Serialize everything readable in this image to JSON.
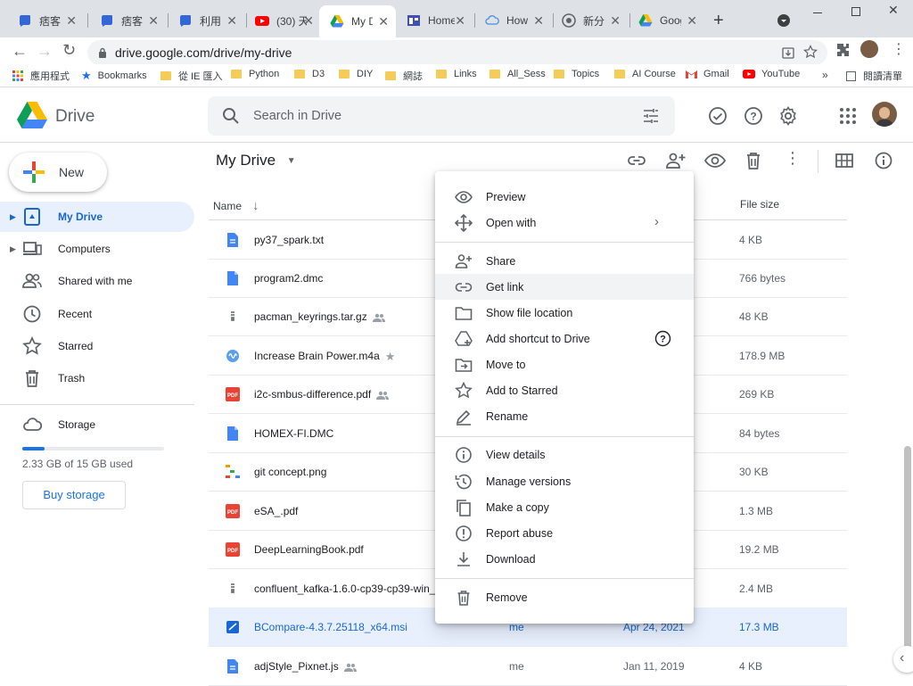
{
  "browser": {
    "tabs": [
      {
        "title": "痞客邦",
        "icon": "pixnet-icon"
      },
      {
        "title": "痞客邦",
        "icon": "pixnet-icon"
      },
      {
        "title": "利用雲",
        "icon": "pixnet-icon"
      },
      {
        "title": "(30) 天",
        "icon": "youtube-icon"
      },
      {
        "title": "My Dr",
        "icon": "drive-icon"
      },
      {
        "title": "Home",
        "icon": "home-icon"
      },
      {
        "title": "How t",
        "icon": "cloud-icon"
      },
      {
        "title": "新分頁",
        "icon": "chrome-icon"
      },
      {
        "title": "Googl",
        "icon": "drive-icon"
      }
    ],
    "url": "drive.google.com/drive/my-drive",
    "bookmarks": [
      {
        "label": "應用程式",
        "icon": "apps-grid-icon"
      },
      {
        "label": "Bookmarks",
        "icon": "star-icon"
      },
      {
        "label": "從 IE 匯入",
        "icon": "folder-icon"
      },
      {
        "label": "Python",
        "icon": "folder-icon"
      },
      {
        "label": "D3",
        "icon": "folder-icon"
      },
      {
        "label": "DIY",
        "icon": "folder-icon"
      },
      {
        "label": "網誌",
        "icon": "folder-icon"
      },
      {
        "label": "Links",
        "icon": "folder-icon"
      },
      {
        "label": "All_Sess",
        "icon": "folder-icon"
      },
      {
        "label": "Topics",
        "icon": "folder-icon"
      },
      {
        "label": "AI Course",
        "icon": "folder-icon"
      },
      {
        "label": "Gmail",
        "icon": "gmail-icon"
      },
      {
        "label": "YouTube",
        "icon": "youtube-icon"
      }
    ],
    "more_bookmarks": "»",
    "reading_list": "閱讀清單"
  },
  "drive": {
    "app_name": "Drive",
    "search_placeholder": "Search in Drive",
    "new_label": "New",
    "nav": [
      {
        "label": "My Drive",
        "icon": "my-drive-icon"
      },
      {
        "label": "Computers",
        "icon": "computers-icon"
      },
      {
        "label": "Shared with me",
        "icon": "shared-icon"
      },
      {
        "label": "Recent",
        "icon": "clock-icon"
      },
      {
        "label": "Starred",
        "icon": "star-icon"
      },
      {
        "label": "Trash",
        "icon": "trash-icon"
      }
    ],
    "storage": {
      "label": "Storage",
      "used_text": "2.33 GB of 15 GB used",
      "used_fraction": 0.155,
      "buy_label": "Buy storage"
    },
    "breadcrumb": "My Drive",
    "columns": {
      "name": "Name",
      "size": "File size"
    },
    "files": [
      {
        "name": "py37_spark.txt",
        "icon": "doc-icon",
        "owner": "",
        "modified": "",
        "size": "4 KB",
        "shared": false,
        "starred": false
      },
      {
        "name": "program2.dmc",
        "icon": "doc-icon",
        "owner": "",
        "modified": "",
        "size": "766 bytes",
        "shared": false,
        "starred": false
      },
      {
        "name": "pacman_keyrings.tar.gz",
        "icon": "archive-icon",
        "owner": "",
        "modified": "",
        "size": "48 KB",
        "shared": true,
        "starred": false
      },
      {
        "name": "Increase Brain Power.m4a",
        "icon": "audio-icon",
        "owner": "",
        "modified": "",
        "size": "178.9 MB",
        "shared": false,
        "starred": true
      },
      {
        "name": "i2c-smbus-difference.pdf",
        "icon": "pdf-icon",
        "owner": "",
        "modified": "",
        "size": "269 KB",
        "shared": true,
        "starred": false
      },
      {
        "name": "HOMEX-FI.DMC",
        "icon": "doc-icon",
        "owner": "",
        "modified": "",
        "size": "84 bytes",
        "shared": false,
        "starred": false
      },
      {
        "name": "git concept.png",
        "icon": "image-icon",
        "owner": "",
        "modified": "",
        "size": "30 KB",
        "shared": false,
        "starred": false
      },
      {
        "name": "eSA_.pdf",
        "icon": "pdf-icon",
        "owner": "",
        "modified": "",
        "size": "1.3 MB",
        "shared": false,
        "starred": false
      },
      {
        "name": "DeepLearningBook.pdf",
        "icon": "pdf-icon",
        "owner": "",
        "modified": "",
        "size": "19.2 MB",
        "shared": false,
        "starred": false
      },
      {
        "name": "confluent_kafka-1.6.0-cp39-cp39-win_",
        "icon": "archive-icon",
        "owner": "",
        "modified": "",
        "size": "2.4 MB",
        "shared": false,
        "starred": false
      },
      {
        "name": "BCompare-4.3.7.25118_x64.msi",
        "icon": "msi-icon",
        "owner": "me",
        "modified": "Apr 24, 2021",
        "size": "17.3 MB",
        "shared": false,
        "starred": false
      },
      {
        "name": "adjStyle_Pixnet.js",
        "icon": "doc-icon",
        "owner": "me",
        "modified": "Jan 11, 2019",
        "size": "4 KB",
        "shared": true,
        "starred": false
      }
    ],
    "context_menu": [
      {
        "label": "Preview",
        "icon": "eye-icon"
      },
      {
        "label": "Open with",
        "icon": "open-with-icon",
        "submenu": true
      },
      {
        "label": "Share",
        "icon": "person-add-icon"
      },
      {
        "label": "Get link",
        "icon": "link-icon"
      },
      {
        "label": "Show file location",
        "icon": "folder-outline-icon"
      },
      {
        "label": "Add shortcut to Drive",
        "icon": "add-shortcut-icon",
        "help": true
      },
      {
        "label": "Move to",
        "icon": "move-to-icon"
      },
      {
        "label": "Add to Starred",
        "icon": "star-outline-icon"
      },
      {
        "label": "Rename",
        "icon": "pencil-icon"
      },
      {
        "label": "View details",
        "icon": "info-icon"
      },
      {
        "label": "Manage versions",
        "icon": "history-icon"
      },
      {
        "label": "Make a copy",
        "icon": "copy-icon"
      },
      {
        "label": "Report abuse",
        "icon": "report-icon"
      },
      {
        "label": "Download",
        "icon": "download-icon"
      },
      {
        "label": "Remove",
        "icon": "trash-icon"
      }
    ],
    "colors": {
      "accent": "#1a73e8",
      "selected_bg": "#e8f0fe",
      "selected_text": "#1967d2",
      "pdf": "#ea4335"
    }
  }
}
